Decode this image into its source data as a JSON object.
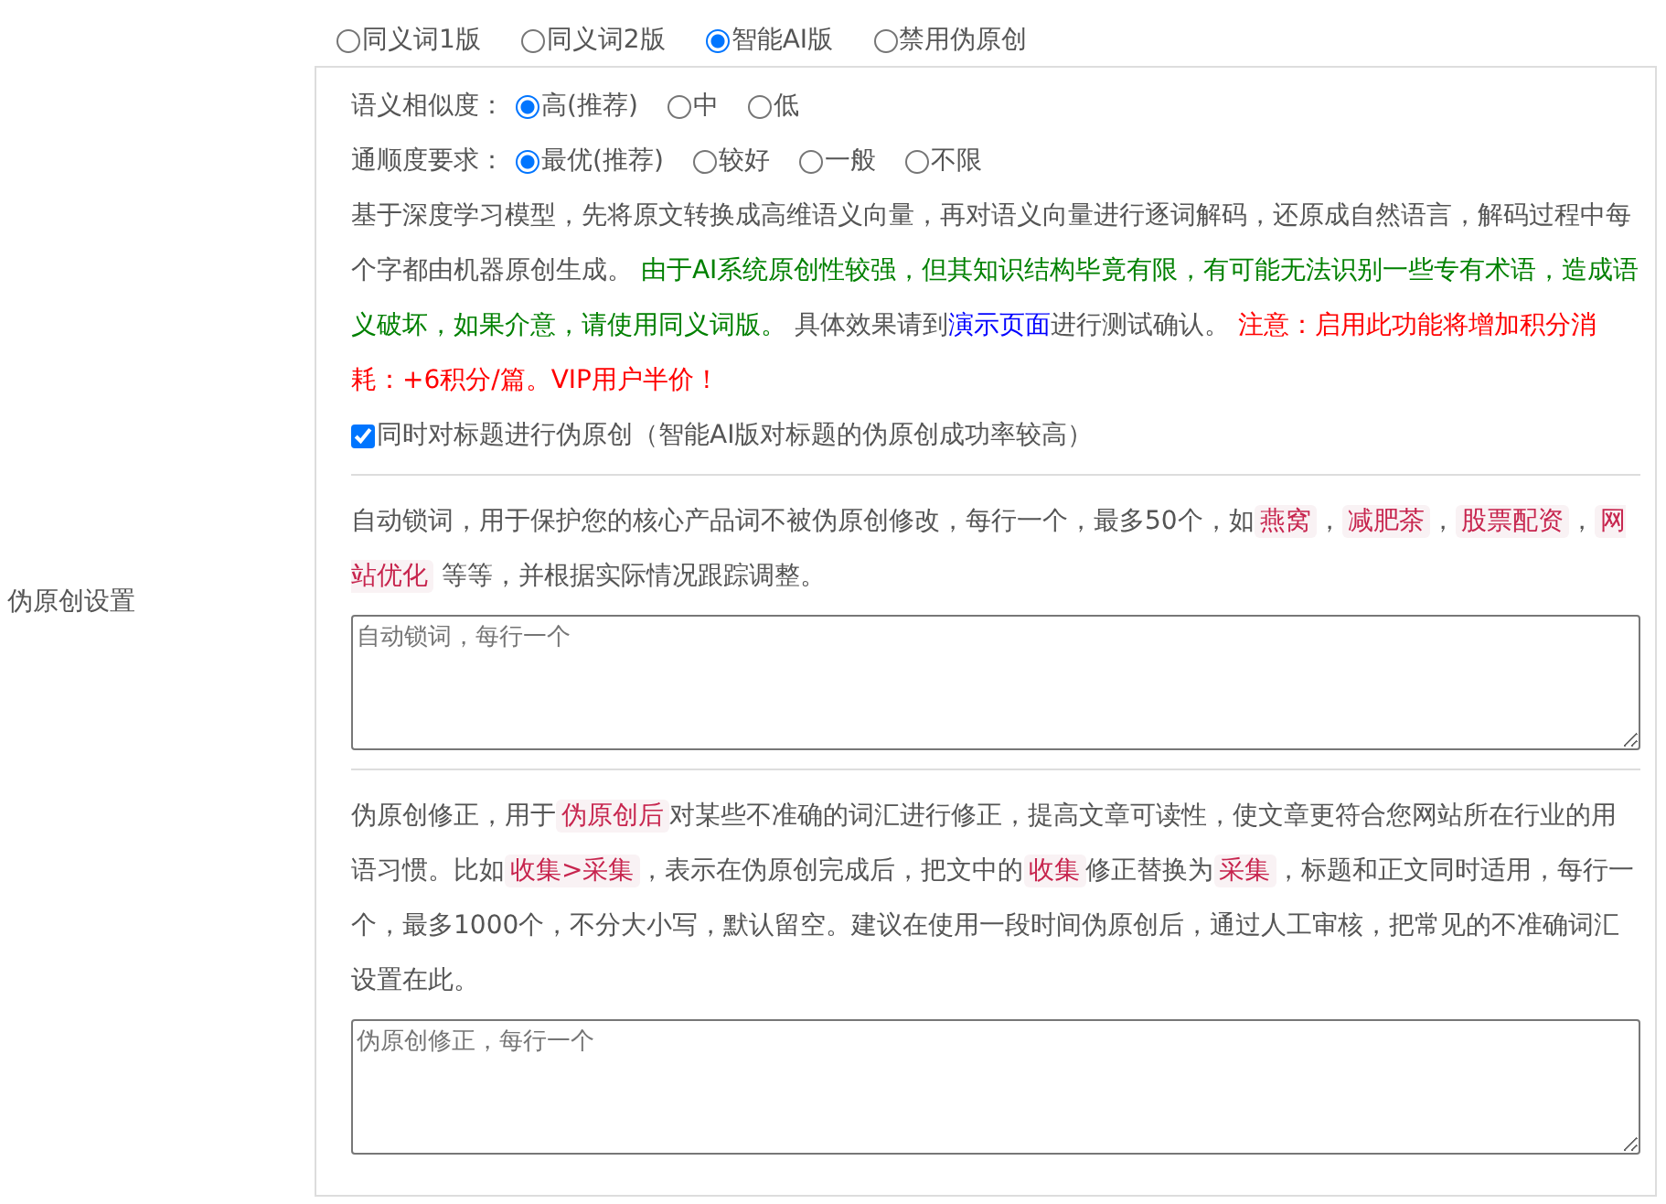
{
  "section_label": "伪原创设置",
  "modes": [
    {
      "label": "同义词1版",
      "selected": false
    },
    {
      "label": "同义词2版",
      "selected": false
    },
    {
      "label": "智能AI版",
      "selected": true
    },
    {
      "label": "禁用伪原创",
      "selected": false
    }
  ],
  "option_groups": [
    {
      "label": "语义相似度：",
      "options": [
        {
          "label": "高(推荐)",
          "selected": true
        },
        {
          "label": "中",
          "selected": false
        },
        {
          "label": "低",
          "selected": false
        }
      ]
    },
    {
      "label": "通顺度要求：",
      "options": [
        {
          "label": "最优(推荐)",
          "selected": true
        },
        {
          "label": "较好",
          "selected": false
        },
        {
          "label": "一般",
          "selected": false
        },
        {
          "label": "不限",
          "selected": false
        }
      ]
    }
  ],
  "ai_description": [
    {
      "kind": "plain",
      "text": "基于深度学习模型，先将原文转换成高维语义向量，再对语义向量进行逐词解码，还原成自然语言，解码过程中每个字都由机器原创生成。 "
    },
    {
      "kind": "green",
      "text": "由于AI系统原创性较强，但其知识结构毕竟有限，有可能无法识别一些专有术语，造成语义破坏，如果介意，请使用同义词版。"
    },
    {
      "kind": "plain",
      "text": " 具体效果请到"
    },
    {
      "kind": "link",
      "text": "演示页面"
    },
    {
      "kind": "plain",
      "text": "进行测试确认。 "
    },
    {
      "kind": "red",
      "text": "注意：启用此功能将增加积分消耗：+6积分/篇。VIP用户半价！"
    }
  ],
  "title_checkbox": {
    "label": "同时对标题进行伪原创（智能AI版对标题的伪原创成功率较高）",
    "checked": true
  },
  "lock_description": [
    {
      "kind": "plain",
      "text": "自动锁词，用于保护您的核心产品词不被伪原创修改，每行一个，最多50个，如"
    },
    {
      "kind": "tag",
      "text": "燕窝"
    },
    {
      "kind": "plain",
      "text": "，"
    },
    {
      "kind": "tag",
      "text": "减肥茶"
    },
    {
      "kind": "plain",
      "text": "，"
    },
    {
      "kind": "tag",
      "text": "股票配资"
    },
    {
      "kind": "plain",
      "text": "，"
    },
    {
      "kind": "tag",
      "text": "网站优化"
    },
    {
      "kind": "plain",
      "text": " 等等，并根据实际情况跟踪调整。"
    }
  ],
  "lock_placeholder": "自动锁词，每行一个",
  "correction_description": [
    {
      "kind": "plain",
      "text": "伪原创修正，用于"
    },
    {
      "kind": "tag",
      "text": "伪原创后"
    },
    {
      "kind": "plain",
      "text": "对某些不准确的词汇进行修正，提高文章可读性，使文章更符合您网站所在行业的用语习惯。比如"
    },
    {
      "kind": "tag",
      "text": "收集>采集"
    },
    {
      "kind": "plain",
      "text": "，表示在伪原创完成后，把文中的"
    },
    {
      "kind": "tag",
      "text": "收集"
    },
    {
      "kind": "plain",
      "text": "修正替换为"
    },
    {
      "kind": "tag",
      "text": "采集"
    },
    {
      "kind": "plain",
      "text": "，标题和正文同时适用，每行一个，最多1000个，不分大小写，默认留空。建议在使用一段时间伪原创后，通过人工审核，把常见的不准确词汇设置在此。"
    }
  ],
  "correction_placeholder": "伪原创修正，每行一个"
}
